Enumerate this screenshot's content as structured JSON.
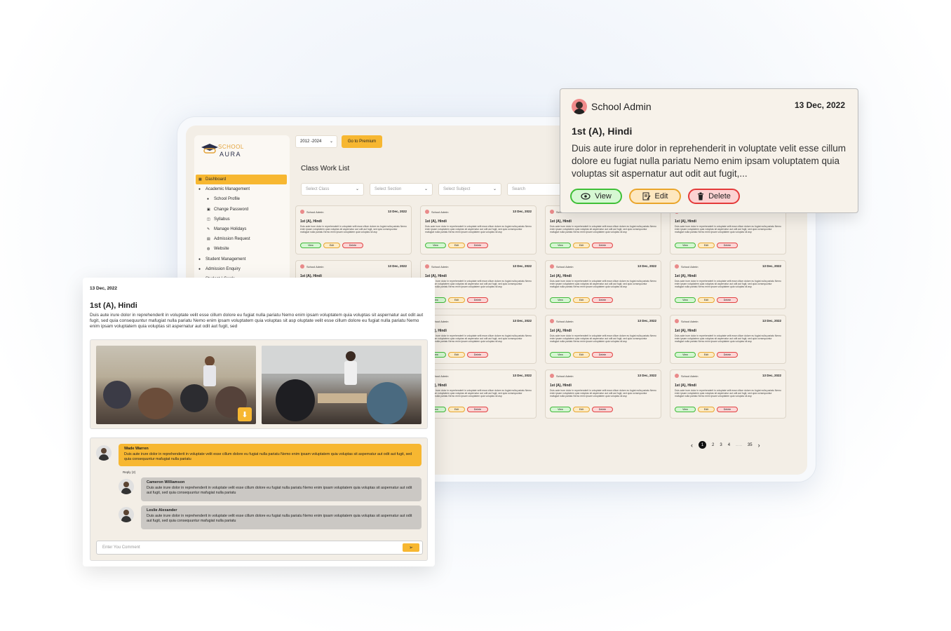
{
  "app": {
    "logo_top": "SCHOOL",
    "logo_bottom": "AURA"
  },
  "topbar": {
    "year": "2012 -2024",
    "premium_label": "Go to Premium"
  },
  "sidebar": {
    "items": [
      {
        "label": "Dashboard",
        "icon": "grid-icon",
        "active": true,
        "sub": false
      },
      {
        "label": "Academic Management",
        "icon": "dot-icon",
        "sub": false
      },
      {
        "label": "School Profile",
        "icon": "dot-icon",
        "sub": true
      },
      {
        "label": "Change Password",
        "icon": "lock-icon",
        "sub": true
      },
      {
        "label": "Syllabus",
        "icon": "book-icon",
        "sub": true
      },
      {
        "label": "Manage Holidays",
        "icon": "pen-icon",
        "sub": true
      },
      {
        "label": "Admission Request",
        "icon": "doc-icon",
        "sub": true
      },
      {
        "label": "Website",
        "icon": "globe-icon",
        "sub": true
      },
      {
        "label": "Student Management",
        "icon": "dot-icon",
        "sub": false
      },
      {
        "label": "Admission Enquiry",
        "icon": "dot-icon",
        "sub": false
      },
      {
        "label": "Student I-Cards",
        "icon": "dot-icon",
        "sub": false
      }
    ]
  },
  "classwork": {
    "title": "Class Work List",
    "filters": {
      "class": "Select Class",
      "section": "Select Section",
      "subject": "Select Subject",
      "search": "Search"
    },
    "card": {
      "author": "School Admin",
      "date": "13 Dec, 2022",
      "title": "1st (A), Hindi",
      "desc": "Duis aute irure dolor in reprehenderit in voluptate velit esse cillum dolore eu fugiat nulla pariatu Nemo enim ipsam voluptatem quia voluptas sit aspernatur aut odit aut fugit, sed quia consequuntur mafugiat nulla pariatu Nemo enim ipsam voluptatem quia voluptas sit asp",
      "view": "View",
      "edit": "Edit",
      "delete": "Delete"
    },
    "pager": {
      "pages": [
        "2",
        "3",
        "4"
      ],
      "current": "1",
      "ellipsis": "........",
      "last": "35"
    }
  },
  "popup": {
    "author": "School Admin",
    "date": "13 Dec, 2022",
    "title": "1st (A), Hindi",
    "desc": "Duis aute irure dolor in reprehenderit in voluptate velit esse cillum dolore eu fugiat nulla pariatu Nemo enim ipsam voluptatem quia voluptas sit aspernatur aut odit aut fugit,...",
    "view": "View",
    "edit": "Edit",
    "delete": "Delete"
  },
  "detail": {
    "date": "13 Dec, 2022",
    "title": "1st (A), Hindi",
    "desc": "Duis aute irure dolor in reprehenderit in voluptate velit esse cillum dolore eu fugiat nulla pariatu Nemo enim ipsam voluptatem quia voluptas sit aspernatur aut odit aut fugit, sed quia consequuntur mafugiat nulla pariatu Nemo enim ipsam voluptatem quia voluptas sit asp oluptate velit esse cillum dolore eu fugiat nulla pariatu Nemo enim ipsam voluptatem quia voluptas sit aspernatur aut odit aut fugit, sed",
    "comments": [
      {
        "name": "Wade Warren",
        "text": "Duis aute irure dolor in reprehenderit in voluptate velit esse cillum dolore eu fugiat nulla pariatu Nemo enim ipsam voluptatem quia voluptas sit aspernatur aut odit aut fugit, sed quia consequuntur mafugiat nulla pariatu"
      },
      {
        "name": "Cameron Williamson",
        "text": "Duis aute irure dolor in reprehenderit in voluptate velit esse cillum dolore eu fugiat nulla pariatu Nemo enim ipsam voluptatem quia voluptas sit aspernatur aut odit aut fugit, sed quia consequuntur mafugiat nulla pariatu"
      },
      {
        "name": "Leslie Alexander",
        "text": "Duis aute irure dolor in reprehenderit in voluptate velit esse cillum dolore eu fugiat nulla pariatu Nemo enim ipsam voluptatem quia voluptas sit aspernatur aut odit aut fugit, sed quia consequuntur mafugiat nulla pariatu"
      }
    ],
    "reply_label": "Reply (2)",
    "comment_placeholder": "Enter You Comment"
  },
  "colors": {
    "accent": "#f7b731",
    "view": "#3fbf37",
    "edit": "#eaa52b",
    "delete": "#e43a3a",
    "panel": "#f3eee6"
  }
}
